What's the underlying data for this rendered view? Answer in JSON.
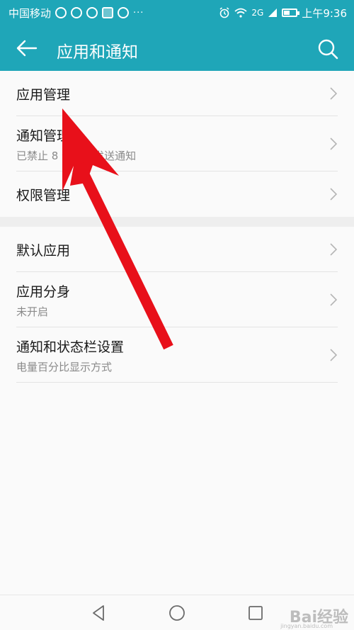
{
  "status_bar": {
    "carrier": "中国移动",
    "dots": "···",
    "network": "2G",
    "time": "上午9:36"
  },
  "app_bar": {
    "title": "应用和通知"
  },
  "section_1": [
    {
      "title": "应用管理",
      "subtitle": ""
    },
    {
      "title": "通知管理",
      "subtitle": "已禁止 8 个应用发送通知"
    },
    {
      "title": "权限管理",
      "subtitle": ""
    }
  ],
  "section_2": [
    {
      "title": "默认应用",
      "subtitle": ""
    },
    {
      "title": "应用分身",
      "subtitle": "未开启"
    },
    {
      "title": "通知和状态栏设置",
      "subtitle": "电量百分比显示方式"
    }
  ],
  "watermark": {
    "text": "Bai经验",
    "sub": "jingyan.baidu.com"
  },
  "colors": {
    "accent": "#1fa6b8",
    "annotation_arrow": "#e8101a"
  }
}
